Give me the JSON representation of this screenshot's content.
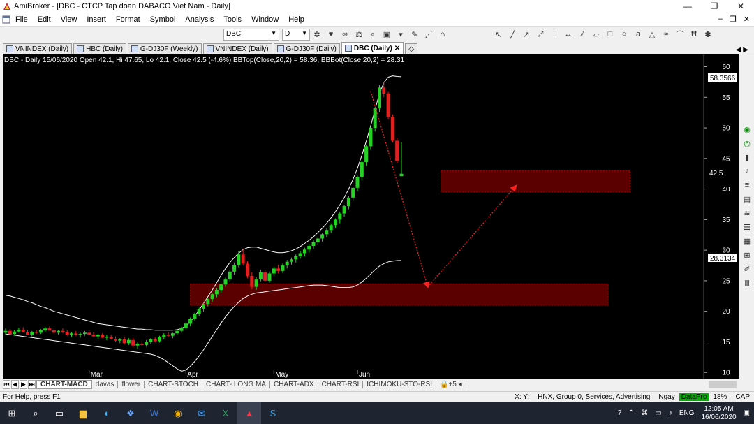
{
  "window": {
    "title": "AmiBroker - [DBC - CTCP Tap doan DABACO Viet Nam - Daily]",
    "controls": [
      "—",
      "❐",
      "✕"
    ]
  },
  "menu": {
    "items": [
      "File",
      "Edit",
      "View",
      "Insert",
      "Format",
      "Symbol",
      "Analysis",
      "Tools",
      "Window",
      "Help"
    ]
  },
  "toolbar": {
    "symbol": "DBC",
    "interval": "D"
  },
  "tabs": [
    {
      "label": "VNINDEX (Daily)"
    },
    {
      "label": "HBC (Daily)"
    },
    {
      "label": "G-DJ30F (Weekly)"
    },
    {
      "label": "VNINDEX (Daily)"
    },
    {
      "label": "G-DJ30F (Daily)"
    },
    {
      "label": "DBC (Daily)",
      "active": true
    }
  ],
  "chart_title": "DBC - Daily 15/06/2020 Open 42.1, Hi 47.65, Lo 42.1, Close 42.5 (-4.6%) BBTop(Close,20,2) = 58.36, BBBot(Close,20,2) = 28.31",
  "price_labels": {
    "bbtop": "58.3566",
    "last": "42.5",
    "bbbot": "28.3134"
  },
  "sheet_tabs": [
    "CHART-MACD",
    "davas",
    "flower",
    "CHART-STOCH",
    "CHART- LONG MA",
    "CHART-ADX",
    "CHART-RSI",
    "ICHIMOKU-STO-RSI"
  ],
  "statusbar": {
    "help": "For Help, press F1",
    "xy": "X:  Y:",
    "info": "HNX, Group 0, Services, Advertising",
    "mode": "Ngay",
    "datapro": "DataPro",
    "percent": "18%",
    "cap": "CAP"
  },
  "taskbar": {
    "time": "12:05 AM",
    "date": "16/06/2020",
    "lang": "ENG"
  },
  "chart_data": {
    "type": "candlestick",
    "y_ticks": [
      10,
      15,
      20,
      25,
      30,
      35,
      40,
      45,
      50,
      55,
      60
    ],
    "ylim": [
      9,
      62
    ],
    "x_labels": [
      {
        "label": "Mar",
        "index": 19
      },
      {
        "label": "Apr",
        "index": 41
      },
      {
        "label": "May",
        "index": 61
      },
      {
        "label": "Jun",
        "index": 80
      }
    ],
    "colors": {
      "up": "#22d322",
      "down": "#e02020",
      "band": "#ffffff",
      "zone": "#5a0000"
    },
    "zones": [
      {
        "name": "support",
        "from": 21.0,
        "to": 24.5,
        "start_index": 42,
        "end_index": 137
      },
      {
        "name": "target",
        "from": 39.5,
        "to": 43.0,
        "start_index": 99,
        "end_index": 142
      }
    ],
    "arrows": [
      {
        "from": [
          83,
          56.0
        ],
        "to": [
          96,
          24.0
        ]
      },
      {
        "from": [
          96,
          24.0
        ],
        "to": [
          116,
          40.5
        ]
      }
    ],
    "candles": [
      [
        16.5,
        17.2,
        16.1,
        16.8
      ],
      [
        16.8,
        17.1,
        16.2,
        16.3
      ],
      [
        16.3,
        16.9,
        16.0,
        16.7
      ],
      [
        16.7,
        17.3,
        16.5,
        17.0
      ],
      [
        17.0,
        17.4,
        16.5,
        16.6
      ],
      [
        16.6,
        16.9,
        16.1,
        16.2
      ],
      [
        16.2,
        16.8,
        15.9,
        16.6
      ],
      [
        16.6,
        17.0,
        16.3,
        16.5
      ],
      [
        16.5,
        17.1,
        16.3,
        16.9
      ],
      [
        16.9,
        17.5,
        16.6,
        17.2
      ],
      [
        17.2,
        17.6,
        16.8,
        16.9
      ],
      [
        16.9,
        17.2,
        16.4,
        16.5
      ],
      [
        16.5,
        17.0,
        16.2,
        16.8
      ],
      [
        16.8,
        17.2,
        16.4,
        16.6
      ],
      [
        16.6,
        16.9,
        16.0,
        16.2
      ],
      [
        16.2,
        16.6,
        15.8,
        16.4
      ],
      [
        16.4,
        16.8,
        16.0,
        16.1
      ],
      [
        16.1,
        16.5,
        15.7,
        16.3
      ],
      [
        16.3,
        16.8,
        16.0,
        16.5
      ],
      [
        16.5,
        16.9,
        16.1,
        16.2
      ],
      [
        16.2,
        16.6,
        15.8,
        15.9
      ],
      [
        15.9,
        16.3,
        15.5,
        16.1
      ],
      [
        16.1,
        16.4,
        15.6,
        15.7
      ],
      [
        15.7,
        16.1,
        15.3,
        15.8
      ],
      [
        15.8,
        16.2,
        15.4,
        15.5
      ],
      [
        15.5,
        15.9,
        15.0,
        15.2
      ],
      [
        15.2,
        15.6,
        14.8,
        15.4
      ],
      [
        15.4,
        15.8,
        14.6,
        14.8
      ],
      [
        14.8,
        15.6,
        14.5,
        15.3
      ],
      [
        15.3,
        15.7,
        14.2,
        14.4
      ],
      [
        14.4,
        14.9,
        13.9,
        14.7
      ],
      [
        14.7,
        15.2,
        14.3,
        14.5
      ],
      [
        14.5,
        15.3,
        14.2,
        15.0
      ],
      [
        15.0,
        15.6,
        14.7,
        15.4
      ],
      [
        15.4,
        15.8,
        14.9,
        15.1
      ],
      [
        15.1,
        16.0,
        14.9,
        15.8
      ],
      [
        15.8,
        16.4,
        15.4,
        16.2
      ],
      [
        16.2,
        16.6,
        15.8,
        16.0
      ],
      [
        16.0,
        16.5,
        15.6,
        16.4
      ],
      [
        16.4,
        17.0,
        16.1,
        16.8
      ],
      [
        16.8,
        17.5,
        16.5,
        17.3
      ],
      [
        17.3,
        18.2,
        17.0,
        18.0
      ],
      [
        18.0,
        19.0,
        17.6,
        18.8
      ],
      [
        18.8,
        19.8,
        18.5,
        19.6
      ],
      [
        19.6,
        20.6,
        19.2,
        20.4
      ],
      [
        20.4,
        21.4,
        20.0,
        21.2
      ],
      [
        21.2,
        22.2,
        20.8,
        22.0
      ],
      [
        22.0,
        23.0,
        21.6,
        22.8
      ],
      [
        22.8,
        23.8,
        22.3,
        23.5
      ],
      [
        23.5,
        24.6,
        23.0,
        24.4
      ],
      [
        24.4,
        25.5,
        24.0,
        25.2
      ],
      [
        25.2,
        26.8,
        24.8,
        26.5
      ],
      [
        26.5,
        28.0,
        26.0,
        27.6
      ],
      [
        27.6,
        29.8,
        27.2,
        29.3
      ],
      [
        29.3,
        30.2,
        27.5,
        27.8
      ],
      [
        27.8,
        28.2,
        25.4,
        25.8
      ],
      [
        25.8,
        26.4,
        23.6,
        24.0
      ],
      [
        24.0,
        25.6,
        23.5,
        25.2
      ],
      [
        25.2,
        26.8,
        24.9,
        26.4
      ],
      [
        26.4,
        26.8,
        24.8,
        25.0
      ],
      [
        25.0,
        26.5,
        24.7,
        26.2
      ],
      [
        26.2,
        27.3,
        25.8,
        27.0
      ],
      [
        27.0,
        27.6,
        26.2,
        26.6
      ],
      [
        26.6,
        27.8,
        26.3,
        27.5
      ],
      [
        27.5,
        28.4,
        27.0,
        28.1
      ],
      [
        28.1,
        28.8,
        27.6,
        28.5
      ],
      [
        28.5,
        29.3,
        28.0,
        29.0
      ],
      [
        29.0,
        29.8,
        28.6,
        29.5
      ],
      [
        29.5,
        30.4,
        29.0,
        30.1
      ],
      [
        30.1,
        31.0,
        29.6,
        30.7
      ],
      [
        30.7,
        31.6,
        30.2,
        31.3
      ],
      [
        31.3,
        32.2,
        30.8,
        31.9
      ],
      [
        31.9,
        32.8,
        31.4,
        32.6
      ],
      [
        32.6,
        33.6,
        32.1,
        33.3
      ],
      [
        33.3,
        34.4,
        32.8,
        34.1
      ],
      [
        34.1,
        35.2,
        33.6,
        35.0
      ],
      [
        35.0,
        36.2,
        34.4,
        36.0
      ],
      [
        36.0,
        37.4,
        35.5,
        37.2
      ],
      [
        37.2,
        38.8,
        36.7,
        38.6
      ],
      [
        38.6,
        40.4,
        38.0,
        40.2
      ],
      [
        40.2,
        42.2,
        39.6,
        42.0
      ],
      [
        42.0,
        44.6,
        41.4,
        44.4
      ],
      [
        44.4,
        47.2,
        43.8,
        47.0
      ],
      [
        47.0,
        50.2,
        46.4,
        50.0
      ],
      [
        50.0,
        53.4,
        49.4,
        53.2
      ],
      [
        53.2,
        57.0,
        52.6,
        56.6
      ],
      [
        56.6,
        57.5,
        55.0,
        55.6
      ],
      [
        55.6,
        56.0,
        51.4,
        51.8
      ],
      [
        51.8,
        52.2,
        47.6,
        47.9
      ],
      [
        47.9,
        48.4,
        44.2,
        44.6
      ],
      [
        42.1,
        47.65,
        42.1,
        42.5
      ]
    ],
    "bb_top": [
      22.6,
      22.5,
      22.3,
      22.1,
      21.9,
      21.6,
      21.4,
      21.1,
      20.8,
      20.6,
      20.3,
      20.0,
      19.8,
      19.6,
      19.4,
      19.2,
      19.0,
      18.8,
      18.6,
      18.4,
      18.2,
      18.0,
      17.9,
      17.8,
      17.7,
      17.6,
      17.5,
      17.4,
      17.3,
      17.2,
      17.1,
      17.1,
      17.0,
      17.0,
      16.9,
      16.9,
      16.9,
      16.9,
      16.9,
      17.0,
      17.2,
      17.6,
      18.3,
      19.2,
      20.2,
      21.3,
      22.4,
      23.5,
      24.7,
      25.9,
      27.0,
      28.0,
      28.8,
      29.5,
      30.1,
      30.4,
      30.5,
      30.5,
      30.3,
      30.1,
      29.9,
      29.7,
      29.6,
      29.6,
      29.7,
      29.9,
      30.2,
      30.6,
      31.1,
      31.6,
      32.2,
      32.9,
      33.6,
      34.4,
      35.3,
      36.3,
      37.4,
      38.6,
      40.0,
      41.6,
      43.4,
      45.5,
      47.8,
      50.3,
      53.0,
      55.6,
      57.4,
      58.3,
      58.5,
      58.4,
      58.36
    ],
    "bb_bot": [
      16.3,
      16.2,
      16.1,
      16.0,
      15.9,
      15.8,
      15.7,
      15.6,
      15.5,
      15.4,
      15.3,
      15.2,
      15.1,
      15.0,
      14.9,
      14.8,
      14.7,
      14.6,
      14.5,
      14.4,
      14.3,
      14.2,
      14.1,
      14.0,
      13.9,
      13.8,
      13.7,
      13.6,
      13.5,
      13.4,
      13.3,
      13.2,
      13.1,
      13.0,
      12.8,
      12.5,
      12.1,
      11.6,
      11.1,
      10.6,
      10.2,
      10.4,
      11.0,
      11.8,
      12.7,
      13.7,
      14.8,
      15.9,
      17.0,
      18.1,
      19.1,
      20.0,
      20.8,
      21.5,
      22.1,
      22.5,
      22.8,
      23.0,
      23.1,
      23.2,
      23.3,
      23.4,
      23.5,
      23.6,
      23.7,
      23.8,
      23.9,
      24.0,
      24.1,
      24.2,
      24.3,
      24.3,
      24.3,
      24.2,
      24.1,
      24.0,
      23.9,
      23.9,
      23.9,
      24.0,
      24.3,
      24.8,
      25.4,
      26.1,
      26.8,
      27.4,
      27.8,
      28.1,
      28.2,
      28.3,
      28.31
    ]
  }
}
